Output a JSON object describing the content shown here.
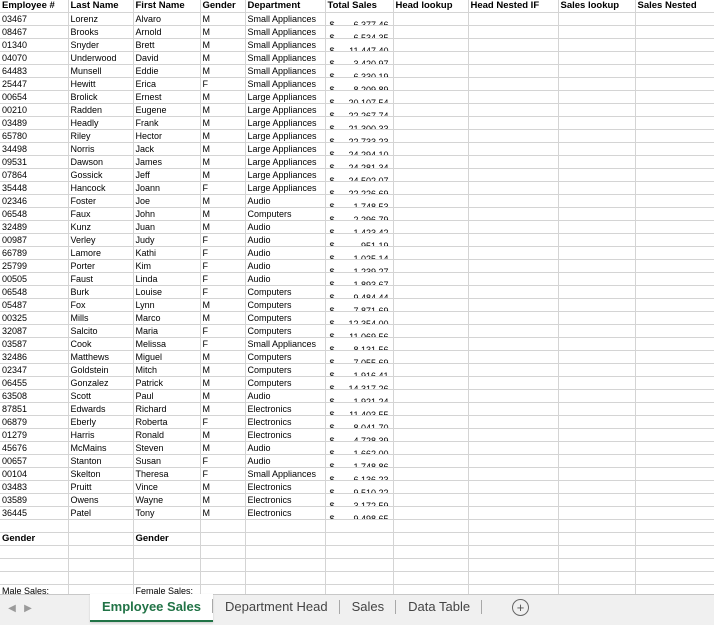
{
  "headers": [
    "Employee #",
    "Last Name",
    "First Name",
    "Gender",
    "Department",
    "Total Sales",
    "Head lookup",
    "Head Nested IF",
    "Sales lookup",
    "Sales Nested"
  ],
  "currency_symbol": "$",
  "rows": [
    [
      "03467",
      "Lorenz",
      "Alvaro",
      "M",
      "Small Appliances",
      "6,377.46"
    ],
    [
      "08467",
      "Brooks",
      "Arnold",
      "M",
      "Small Appliances",
      "6,534.35"
    ],
    [
      "01340",
      "Snyder",
      "Brett",
      "M",
      "Small Appliances",
      "11,447.40"
    ],
    [
      "04070",
      "Underwood",
      "David",
      "M",
      "Small Appliances",
      "3,420.97"
    ],
    [
      "64483",
      "Munsell",
      "Eddie",
      "M",
      "Small Appliances",
      "6,330.19"
    ],
    [
      "25447",
      "Hewitt",
      "Erica",
      "F",
      "Small Appliances",
      "8,209.89"
    ],
    [
      "00654",
      "Brolick",
      "Ernest",
      "M",
      "Large Appliances",
      "20,107.54"
    ],
    [
      "00210",
      "Radden",
      "Eugene",
      "M",
      "Large Appliances",
      "22,267.74"
    ],
    [
      "03489",
      "Headly",
      "Frank",
      "M",
      "Large Appliances",
      "21,300.33"
    ],
    [
      "65780",
      "Riley",
      "Hector",
      "M",
      "Large Appliances",
      "22,733.23"
    ],
    [
      "34498",
      "Norris",
      "Jack",
      "M",
      "Large Appliances",
      "24,294.10"
    ],
    [
      "09531",
      "Dawson",
      "James",
      "M",
      "Large Appliances",
      "24,281.34"
    ],
    [
      "07864",
      "Gossick",
      "Jeff",
      "M",
      "Large Appliances",
      "24,502.07"
    ],
    [
      "35448",
      "Hancock",
      "Joann",
      "F",
      "Large Appliances",
      "22,226.69"
    ],
    [
      "02346",
      "Foster",
      "Joe",
      "M",
      "Audio",
      "1,748.53"
    ],
    [
      "06548",
      "Faux",
      "John",
      "M",
      "Computers",
      "2,296.79"
    ],
    [
      "32489",
      "Kunz",
      "Juan",
      "M",
      "Audio",
      "1,423.42"
    ],
    [
      "00987",
      "Verley",
      "Judy",
      "F",
      "Audio",
      "951.19"
    ],
    [
      "66789",
      "Lamore",
      "Kathi",
      "F",
      "Audio",
      "1,025.14"
    ],
    [
      "25799",
      "Porter",
      "Kim",
      "F",
      "Audio",
      "1,239.27"
    ],
    [
      "00505",
      "Faust",
      "Linda",
      "F",
      "Audio",
      "1,893.67"
    ],
    [
      "06548",
      "Burk",
      "Louise",
      "F",
      "Computers",
      "9,484.44"
    ],
    [
      "05487",
      "Fox",
      "Lynn",
      "M",
      "Computers",
      "7,871.69"
    ],
    [
      "00325",
      "Mills",
      "Marco",
      "M",
      "Computers",
      "12,354.00"
    ],
    [
      "32087",
      "Salcito",
      "Maria",
      "F",
      "Computers",
      "11,069.56"
    ],
    [
      "03587",
      "Cook",
      "Melissa",
      "F",
      "Small Appliances",
      "8,131.56"
    ],
    [
      "32486",
      "Matthews",
      "Miguel",
      "M",
      "Computers",
      "7,055.69"
    ],
    [
      "02347",
      "Goldstein",
      "Mitch",
      "M",
      "Computers",
      "1,916.41"
    ],
    [
      "06455",
      "Gonzalez",
      "Patrick",
      "M",
      "Computers",
      "14,317.26"
    ],
    [
      "63508",
      "Scott",
      "Paul",
      "M",
      "Audio",
      "1,921.24"
    ],
    [
      "87851",
      "Edwards",
      "Richard",
      "M",
      "Electronics",
      "11,403.55"
    ],
    [
      "06879",
      "Eberly",
      "Roberta",
      "F",
      "Electronics",
      "8,041.70"
    ],
    [
      "01279",
      "Harris",
      "Ronald",
      "M",
      "Electronics",
      "4,728.39"
    ],
    [
      "45676",
      "McMains",
      "Steven",
      "M",
      "Audio",
      "1,662.00"
    ],
    [
      "00657",
      "Stanton",
      "Susan",
      "F",
      "Audio",
      "1,748.86"
    ],
    [
      "00104",
      "Skelton",
      "Theresa",
      "F",
      "Small Appliances",
      "6,136.23"
    ],
    [
      "03483",
      "Pruitt",
      "Vince",
      "M",
      "Electronics",
      "9,510.22"
    ],
    [
      "03589",
      "Owens",
      "Wayne",
      "M",
      "Electronics",
      "3,172.59"
    ],
    [
      "36445",
      "Patel",
      "Tony",
      "M",
      "Electronics",
      "9,498.65"
    ]
  ],
  "summary": {
    "gender_label_1": "Gender",
    "gender_label_2": "Gender",
    "male_sales_label": "Male Sales:",
    "female_sales_label": "Female Sales:"
  },
  "tabs": {
    "items": [
      "Employee Sales",
      "Department Head",
      "Sales",
      "Data Table"
    ],
    "active_index": 0,
    "prev_icon": "chevron-left-icon",
    "next_icon": "chevron-right-icon",
    "add_icon": "plus-circle-icon"
  }
}
